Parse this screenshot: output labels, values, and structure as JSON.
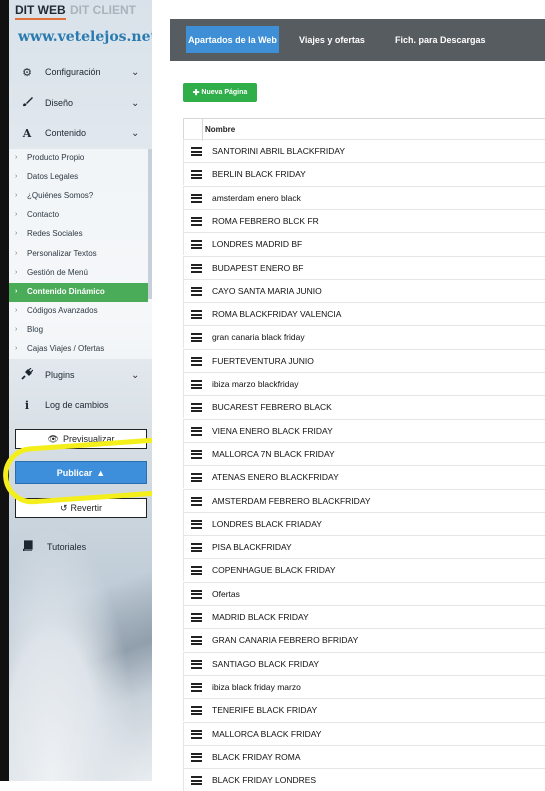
{
  "sidebar": {
    "tab_dit": "DIT WEB",
    "tab_client": "DIT CLIENT",
    "site_url": "www.vetelejos.net",
    "menu": [
      {
        "label": "Configuración",
        "icon": "gear-icon",
        "glyph": "⚙",
        "chevron": true
      },
      {
        "label": "Diseño",
        "icon": "brush-icon",
        "glyph": "🖌",
        "chevron": true
      },
      {
        "label": "Contenido",
        "icon": "font-icon",
        "glyph": "A",
        "chevron": true
      }
    ],
    "submenu": [
      "Producto Propio",
      "Datos Legales",
      "¿Quiénes Somos?",
      "Contacto",
      "Redes Sociales",
      "Personalizar Textos",
      "Gestión de Menú",
      "Contenido Dinámico",
      "Códigos Avanzados",
      "Blog",
      "Cajas Viajes / Ofertas"
    ],
    "active_submenu": "Contenido Dinámico",
    "plugins_label": "Plugins",
    "log_label": "Log de cambios",
    "preview_label": "Previsualizar",
    "publish_label": "Publicar",
    "revert_label": "Revertir",
    "tutorials_label": "Tutoriales"
  },
  "topnav": {
    "tabs": [
      "Apartados de la Web",
      "Viajes y ofertas",
      "Fich. para Descargas"
    ],
    "active": "Apartados de la Web"
  },
  "main": {
    "new_page_button": "Nueva Página",
    "column_header": "Nombre",
    "rows": [
      "SANTORINI ABRIL BLACKFRIDAY",
      "BERLIN BLACK FRIDAY",
      "amsterdam enero black",
      "ROMA FEBRERO BLCK FR",
      "LONDRES MADRID BF",
      "BUDAPEST ENERO BF",
      "CAYO SANTA MARIA JUNIO",
      "ROMA BLACKFRIDAY VALENCIA",
      "gran canaria black friday",
      "FUERTEVENTURA JUNIO",
      "ibiza marzo blackfriday",
      "BUCAREST FEBRERO BLACK",
      "VIENA ENERO BLACK FRIDAY",
      "MALLORCA 7N BLACK FRIDAY",
      "ATENAS ENERO BLACKFRIDAY",
      "AMSTERDAM FEBRERO BLACKFRIDAY",
      "LONDRES BLACK FRIADAY",
      "PISA BLACKFRIDAY",
      "COPENHAGUE BLACK FRIDAY",
      "Ofertas",
      "MADRID BLACK FRIDAY",
      "GRAN CANARIA FEBRERO BFRIDAY",
      "SANTIAGO BLACK FRIDAY",
      "ibiza black friday marzo",
      "TENERIFE BLACK FRIDAY",
      "MALLORCA BLACK FRIDAY",
      "BLACK FRIDAY ROMA",
      "BLACK FRIDAY LONDRES"
    ]
  },
  "colors": {
    "active_green": "#4aab58",
    "publish_blue": "#3d8fdc",
    "topbar_gray": "#575c61",
    "highlight_yellow": "#f4ef1a"
  }
}
